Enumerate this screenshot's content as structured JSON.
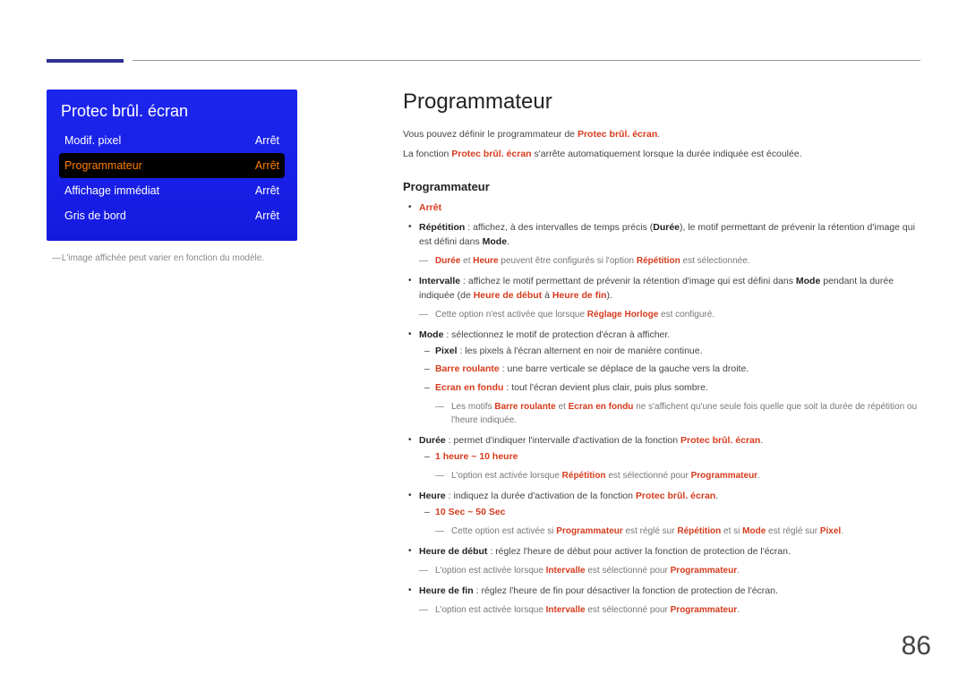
{
  "page_number": "86",
  "osd": {
    "title": "Protec brûl. écran",
    "rows": [
      {
        "label": "Modif. pixel",
        "value": "Arrêt",
        "selected": false
      },
      {
        "label": "Programmateur",
        "value": "Arrêt",
        "selected": true
      },
      {
        "label": "Affichage immédiat",
        "value": "Arrêt",
        "selected": false
      },
      {
        "label": "Gris de bord",
        "value": "Arrêt",
        "selected": false
      }
    ],
    "note": "L'image affichée peut varier en fonction du modèle."
  },
  "content": {
    "heading": "Programmateur",
    "intro1_pre": "Vous pouvez définir le programmateur de ",
    "intro1_red": "Protec brûl. écran",
    "intro1_post": ".",
    "intro2_pre": "La fonction ",
    "intro2_red": "Protec brûl. écran",
    "intro2_post": " s'arrête automatiquement lorsque la durée indiquée est écoulée.",
    "subheading": "Programmateur",
    "li_arret": "Arrêt",
    "rep_bold": "Répétition",
    "rep_txt1": " : affichez, à des intervalles de temps précis (",
    "rep_bold2": "Durée",
    "rep_txt2": "), le motif permettant de prévenir la rétention d'image qui est défini dans ",
    "rep_bold3": "Mode",
    "rep_txt3": ".",
    "rep_note_r1": "Durée",
    "rep_note_t1": " et ",
    "rep_note_r2": "Heure",
    "rep_note_t2": " peuvent être configurés si l'option ",
    "rep_note_r3": "Répétition",
    "rep_note_t3": " est sélectionnée.",
    "int_bold": "Intervalle",
    "int_txt1": " : affichez le motif permettant de prévenir la rétention d'image qui est défini dans ",
    "int_bold2": "Mode",
    "int_txt2": " pendant la durée indiquée (de ",
    "int_red1": "Heure de début",
    "int_txt3": " à ",
    "int_red2": "Heure de fin",
    "int_txt4": ").",
    "int_note_t1": "Cette option n'est activée que lorsque ",
    "int_note_r1": "Réglage Horloge",
    "int_note_t2": " est configuré.",
    "mode_bold": "Mode",
    "mode_txt": " : sélectionnez le motif de protection d'écran à afficher.",
    "mode_d1_b": "Pixel",
    "mode_d1_t": " : les pixels à l'écran alternent en noir de manière continue.",
    "mode_d2_r": "Barre roulante",
    "mode_d2_t": " : une barre verticale se déplace de la gauche vers la droite.",
    "mode_d3_r": "Ecran en fondu",
    "mode_d3_t": " : tout l'écran devient plus clair, puis plus sombre.",
    "mode_note_t1": "Les motifs ",
    "mode_note_r1": "Barre roulante",
    "mode_note_t2": " et ",
    "mode_note_r2": "Ecran en fondu",
    "mode_note_t3": " ne s'affichent qu'une seule fois quelle que soit la durée de répétition ou l'heure indiquée.",
    "dur_bold": "Durée",
    "dur_txt1": " : permet d'indiquer l'intervalle d'activation de la fonction ",
    "dur_red": "Protec brûl. écran",
    "dur_txt2": ".",
    "dur_d1": "1 heure ~ 10 heure",
    "dur_note_t1": "L'option est activée lorsque ",
    "dur_note_r1": "Répétition",
    "dur_note_t2": " est sélectionné pour ",
    "dur_note_r2": "Programmateur",
    "dur_note_t3": ".",
    "heu_bold": "Heure",
    "heu_txt1": " : indiquez la durée d'activation de la fonction ",
    "heu_red": "Protec brûl. écran",
    "heu_txt2": ".",
    "heu_d1": "10 Sec ~ 50 Sec",
    "heu_note_t1": "Cette option est activée si ",
    "heu_note_r1": "Programmateur",
    "heu_note_t2": " est réglé sur ",
    "heu_note_r2": "Répétition",
    "heu_note_t3": " et si ",
    "heu_note_r3": "Mode",
    "heu_note_t4": " est réglé sur ",
    "heu_note_r4": "Pixel",
    "heu_note_t5": ".",
    "hdd_bold": "Heure de début",
    "hdd_txt": " : réglez l'heure de début pour activer la fonction de protection de l'écran.",
    "hdd_note_t1": "L'option est activée lorsque ",
    "hdd_note_r1": "Intervalle",
    "hdd_note_t2": " est sélectionné pour ",
    "hdd_note_r2": "Programmateur",
    "hdd_note_t3": ".",
    "hdf_bold": "Heure de fin",
    "hdf_txt": " : réglez l'heure de fin pour désactiver la fonction de protection de l'écran.",
    "hdf_note_t1": "L'option est activée lorsque ",
    "hdf_note_r1": "Intervalle",
    "hdf_note_t2": " est sélectionné pour ",
    "hdf_note_r2": "Programmateur",
    "hdf_note_t3": "."
  }
}
